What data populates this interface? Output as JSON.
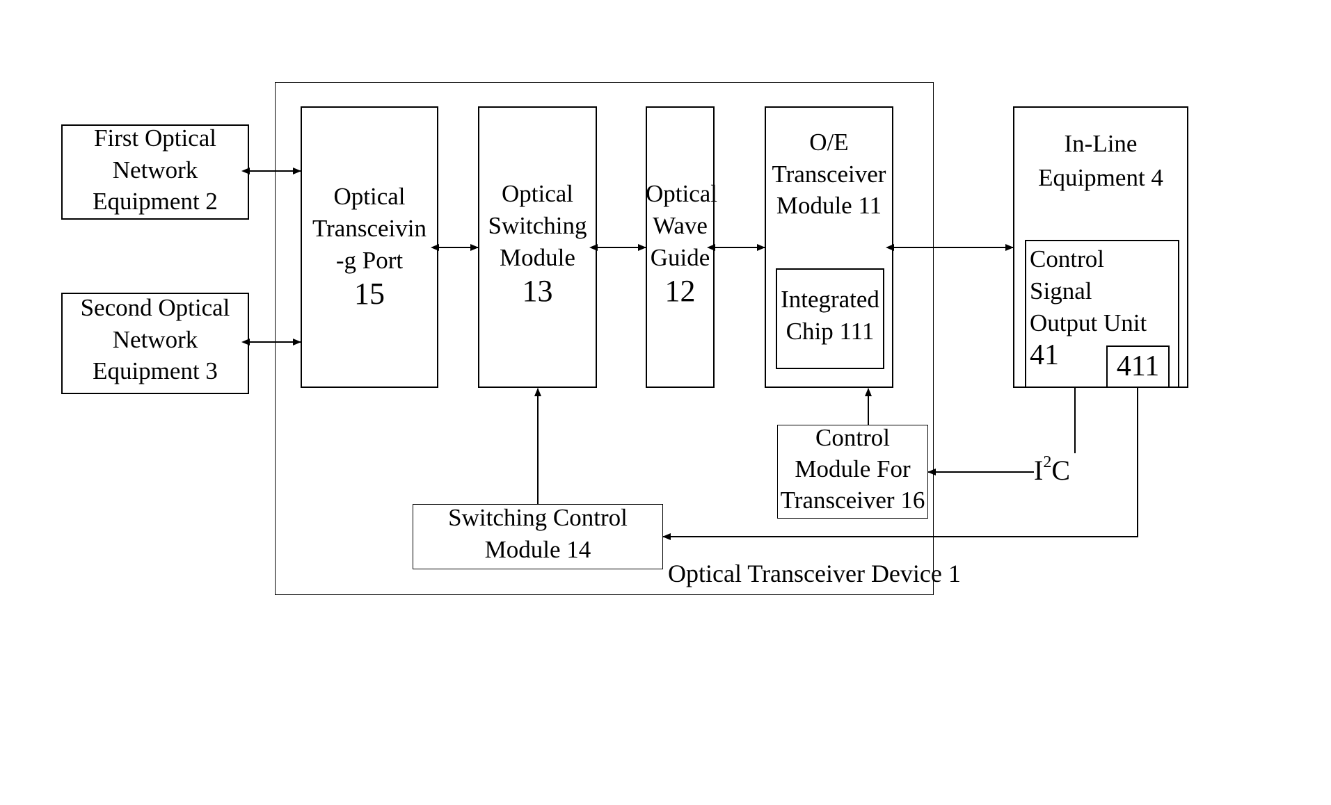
{
  "diagram": {
    "device": {
      "label": "Optical Transceiver Device 1"
    },
    "first_equipment": {
      "lines": [
        "First Optical",
        "Network",
        "Equipment 2"
      ]
    },
    "second_equipment": {
      "lines": [
        "Second Optical",
        "Network",
        "Equipment 3"
      ]
    },
    "port": {
      "lines": [
        "Optical",
        "Transceivin",
        "-g Port"
      ],
      "number": "15"
    },
    "switching_module": {
      "lines": [
        "Optical",
        "Switching",
        "Module"
      ],
      "number": "13"
    },
    "wave_guide": {
      "lines": [
        "Optical",
        "Wave",
        "Guide"
      ],
      "number": "12"
    },
    "oe_module": {
      "lines": [
        "O/E",
        "Transceiver",
        "Module 11"
      ]
    },
    "chip": {
      "lines": [
        "Integrated",
        "Chip 111"
      ]
    },
    "control_module": {
      "lines": [
        "Control",
        "Module For",
        "Transceiver 16"
      ]
    },
    "switching_control": {
      "lines": [
        "Switching Control",
        "Module 14"
      ]
    },
    "inline_equipment": {
      "lines": [
        "In-Line",
        "Equipment 4"
      ]
    },
    "signal_unit": {
      "lines": [
        "Control",
        "Signal",
        "Output Unit"
      ],
      "number": "41"
    },
    "sub_unit": {
      "label": "411"
    },
    "bus_label": {
      "base_1": "I",
      "sup": "2",
      "base_2": "C"
    }
  }
}
